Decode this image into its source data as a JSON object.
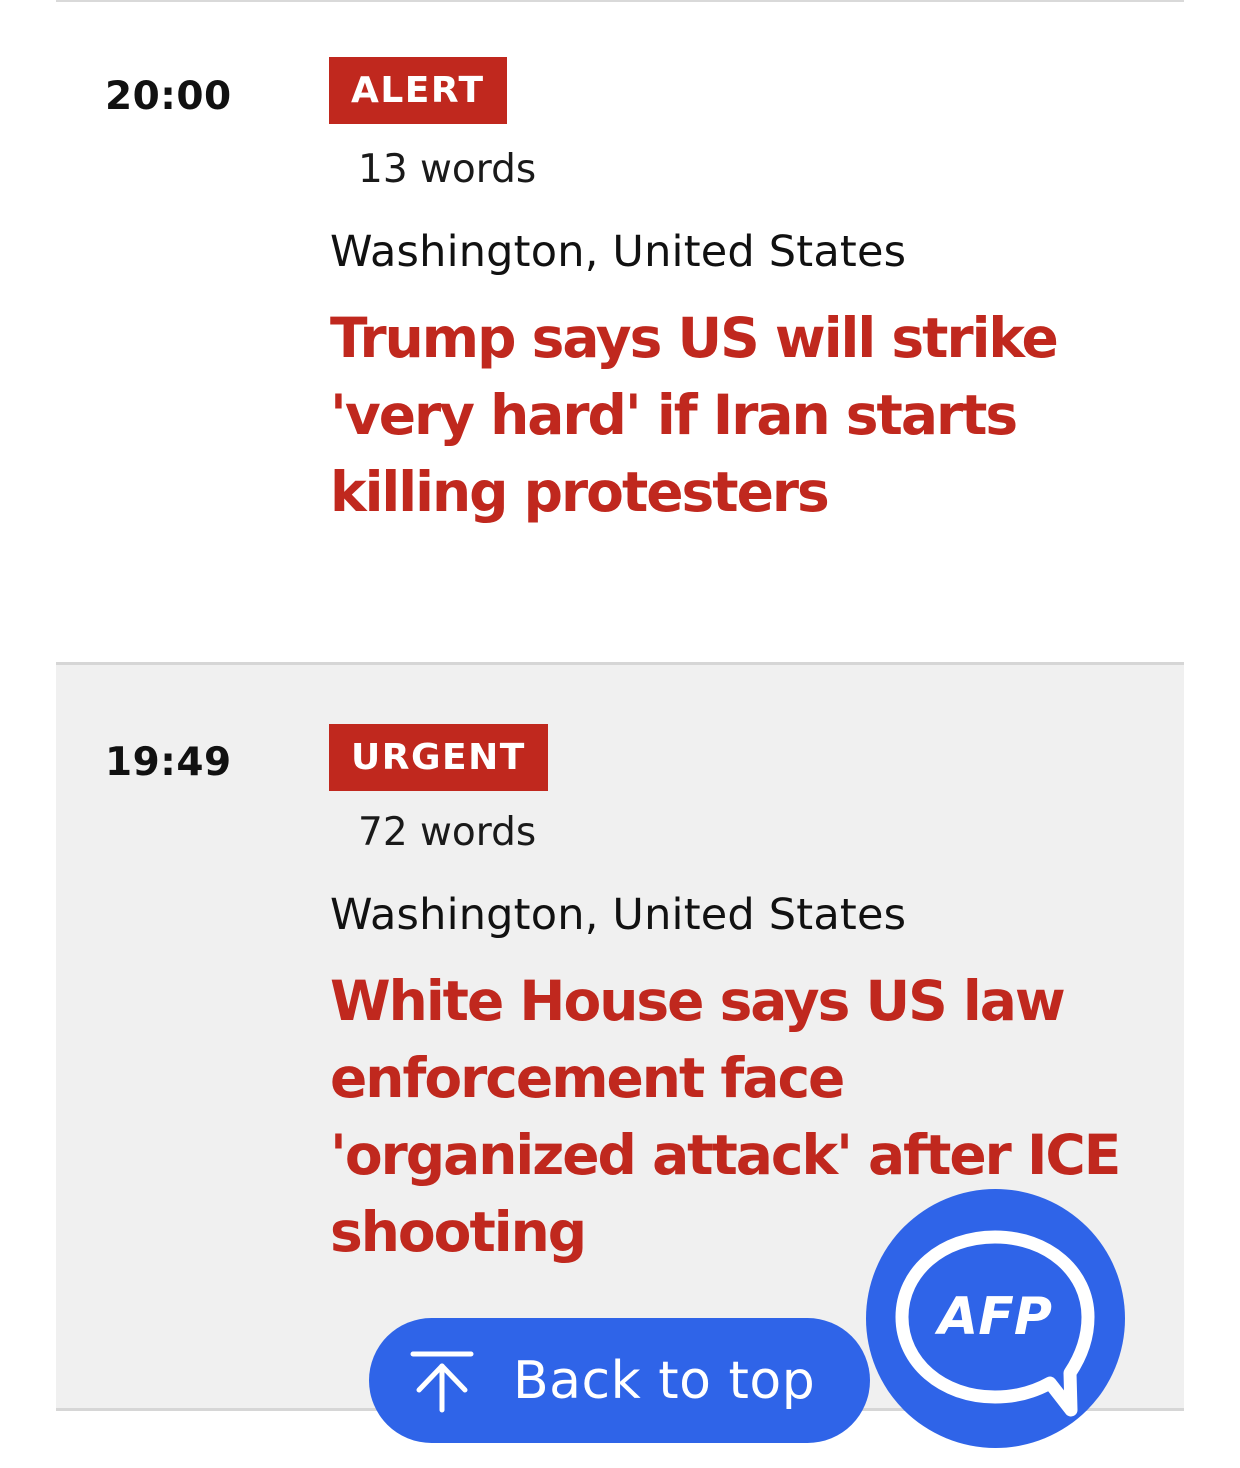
{
  "feed": {
    "items": [
      {
        "time": "20:00",
        "badge": "ALERT",
        "word_count": "13 words",
        "location": "Washington, United States",
        "headline": "Trump says US will strike 'very hard' if Iran starts killing protesters"
      },
      {
        "time": "19:49",
        "badge": "URGENT",
        "word_count": "72 words",
        "location": "Washington, United States",
        "headline": "White House says US law enforcement face 'organized attack' after ICE shooting"
      }
    ]
  },
  "back_to_top": {
    "label": "Back to top",
    "icon": "arrow-up-to-line-icon"
  },
  "afp_chat": {
    "label": "AFP",
    "icon": "chat-bubble-icon"
  },
  "colors": {
    "accent_red": "#c0281e",
    "button_blue": "#2f64e8",
    "alt_row_bg": "#f0f0f0"
  }
}
